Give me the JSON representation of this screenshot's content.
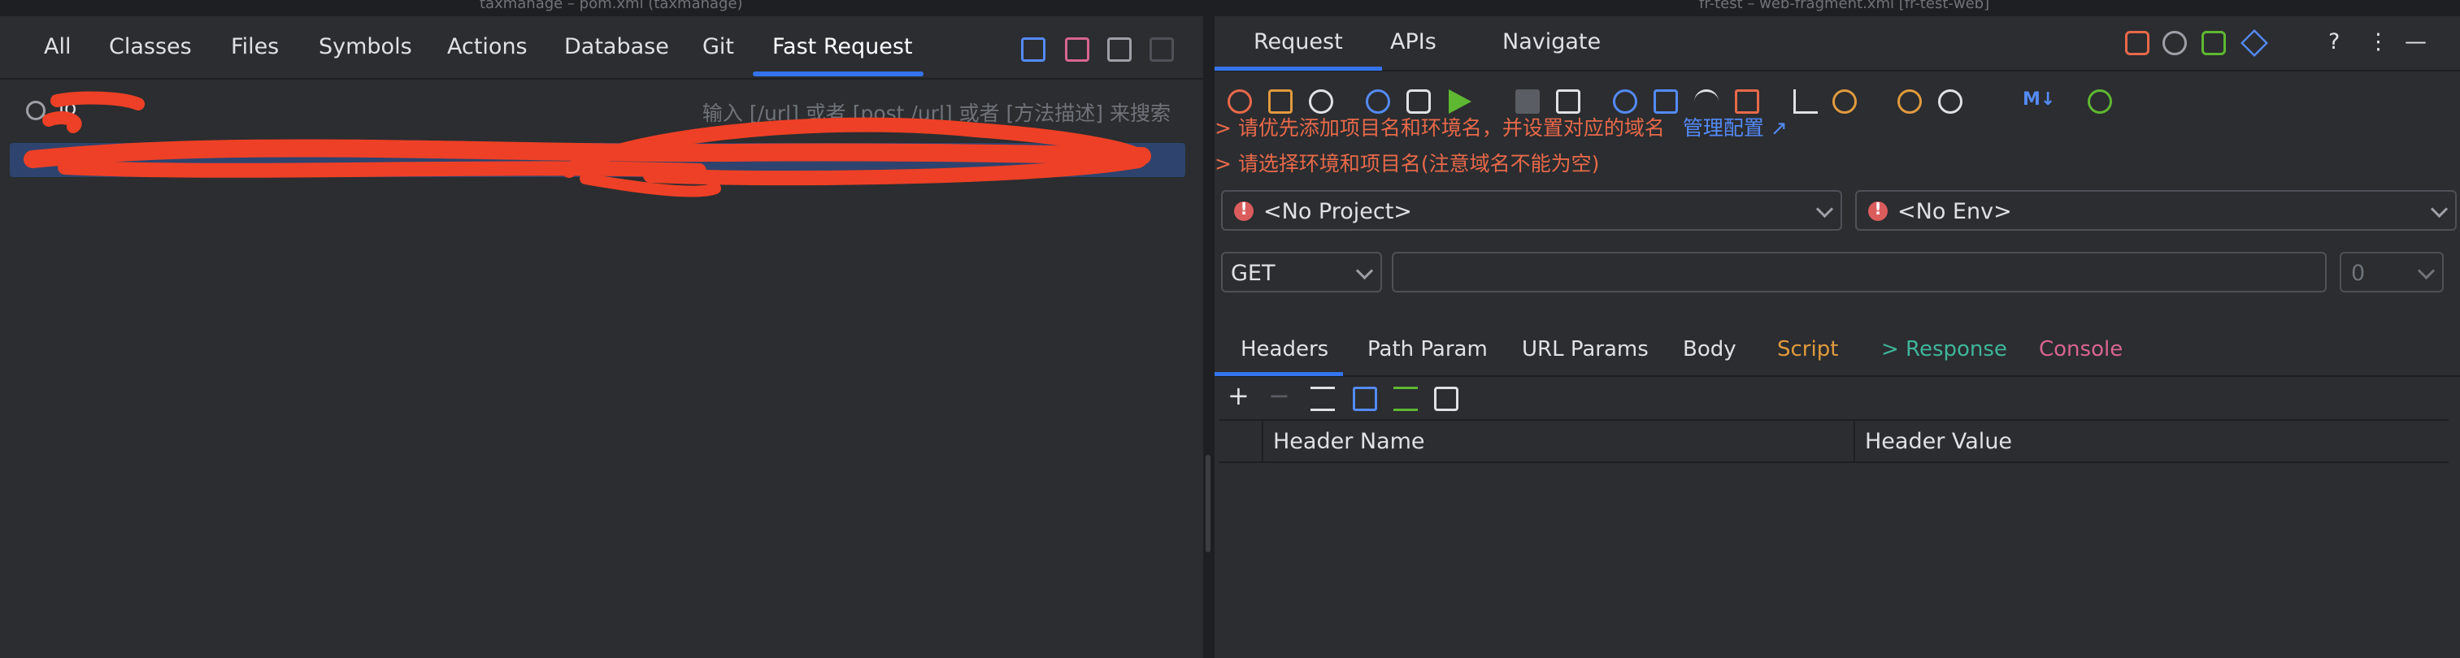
{
  "window_titles": {
    "left": "taxmanage – pom.xml (taxmanage)",
    "right": "fr-test – web-fragment.xml [fr-test-web]"
  },
  "search_everywhere": {
    "tabs": [
      "All",
      "Classes",
      "Files",
      "Symbols",
      "Actions",
      "Database",
      "Git",
      "Fast Request"
    ],
    "active_tab": "Fast Request",
    "query": "lo",
    "placeholder": "输入 [/url] 或者 [post /url] 或者 [方法描述] 来搜索"
  },
  "fast_request": {
    "tabs": [
      "Request",
      "APIs",
      "Navigate"
    ],
    "active_tab": "Request",
    "messages": [
      {
        "text": "> 请优先添加项目名和环境名，并设置对应的域名",
        "link": "管理配置 ↗"
      },
      {
        "text": "> 请选择环境和项目名(注意域名不能为空)",
        "link": ""
      }
    ],
    "project_select": "<No Project>",
    "env_select": "<No Env>",
    "method": "GET",
    "url": "",
    "count": "0",
    "sub_tabs": [
      {
        "label": "Headers",
        "color": "#dfe1e5"
      },
      {
        "label": "Path Param",
        "color": "#dfe1e5"
      },
      {
        "label": "URL Params",
        "color": "#dfe1e5"
      },
      {
        "label": "Body",
        "color": "#dfe1e5"
      },
      {
        "label": "Script",
        "color": "#e09a3e"
      },
      {
        "label": "> Response",
        "color": "#3fb59b"
      },
      {
        "label": "Console",
        "color": "#d9658f"
      }
    ],
    "header_columns": [
      "Header Name",
      "Header Value"
    ]
  },
  "colors": {
    "accent": "#3574f0",
    "warning": "#e8694a",
    "link": "#548af7"
  }
}
